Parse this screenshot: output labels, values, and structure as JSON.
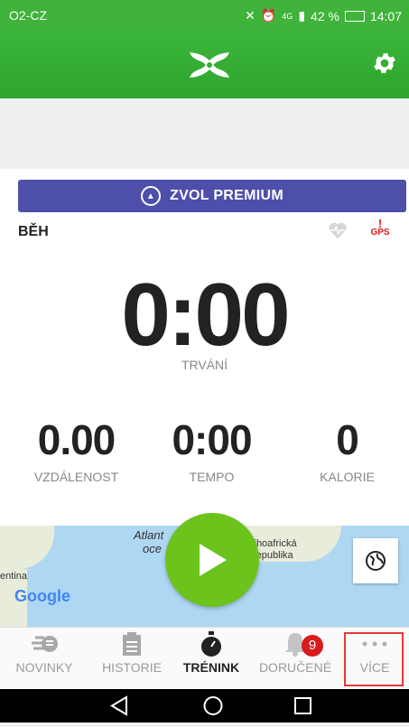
{
  "status_bar": {
    "carrier": "O2-CZ",
    "network": "4G",
    "battery": "42 %",
    "time": "14:07"
  },
  "premium": {
    "label": "ZVOL PREMIUM"
  },
  "workout": {
    "activity": "BĚH",
    "gps_label": "GPS",
    "duration_value": "0:00",
    "duration_label": "TRVÁNÍ",
    "stats": [
      {
        "value": "0.00",
        "label": "VZDÁLENOST"
      },
      {
        "value": "0:00",
        "label": "TEMPO"
      },
      {
        "value": "0",
        "label": "KALORIE"
      }
    ]
  },
  "map": {
    "text_atlantic_1": "Atlant",
    "text_atlantic_2": "oce",
    "text_africa_1": "Jihoafrická",
    "text_africa_2": "republika",
    "text_argentina": "entina",
    "attribution": "Google"
  },
  "tabs": [
    {
      "label": "NOVINKY",
      "icon": "feed-icon"
    },
    {
      "label": "HISTORIE",
      "icon": "history-icon"
    },
    {
      "label": "TRÉNINK",
      "icon": "stopwatch-icon"
    },
    {
      "label": "DORUČENÉ",
      "icon": "bell-icon",
      "badge": "9"
    },
    {
      "label": "VÍCE",
      "icon": "more-icon"
    }
  ],
  "colors": {
    "green": "#3cb63a",
    "premium": "#4e4eab",
    "play": "#6bc31c",
    "alert": "#d81c1c"
  }
}
